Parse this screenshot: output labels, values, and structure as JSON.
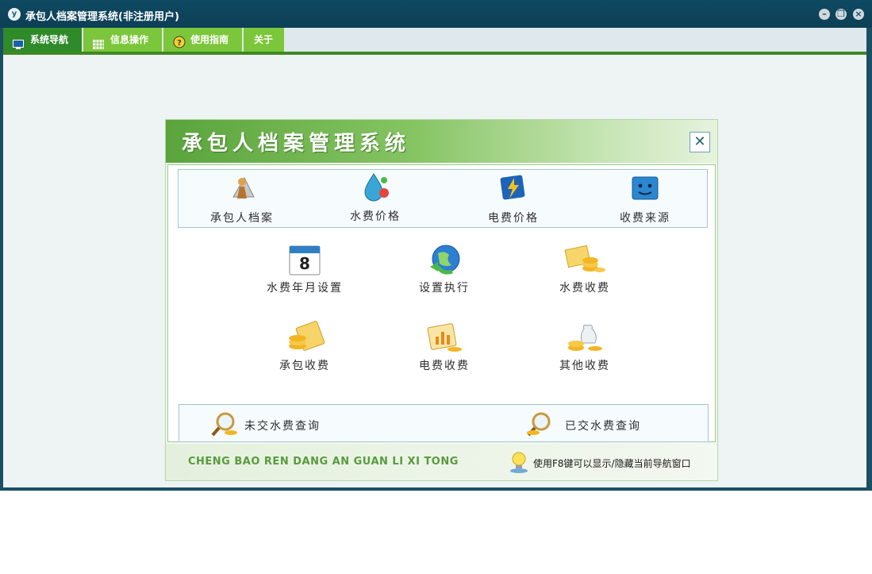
{
  "window": {
    "title": "承包人档案管理系统(非注册用户)",
    "app_icon_letter": "y",
    "controls": {
      "minimize": "–",
      "restore": "❐",
      "close": "×"
    }
  },
  "menu": {
    "items": [
      {
        "label": "系统导航",
        "icon": "monitor-icon",
        "active": true
      },
      {
        "label": "信息操作",
        "icon": "grid-icon",
        "active": false
      },
      {
        "label": "使用指南",
        "icon": "help-icon",
        "active": false
      },
      {
        "label": "关于",
        "icon": "",
        "active": false
      }
    ]
  },
  "nav": {
    "title": "承包人档案管理系统",
    "close": "✕",
    "top_row": [
      {
        "label": "承包人档案",
        "icon": "contractor-profile-icon"
      },
      {
        "label": "水费价格",
        "icon": "water-drop-icon"
      },
      {
        "label": "电费价格",
        "icon": "lightning-icon"
      },
      {
        "label": "收费来源",
        "icon": "finder-face-icon"
      }
    ],
    "grid": [
      {
        "label": "水费年月设置",
        "icon": "calendar-icon",
        "calendar_day": "8"
      },
      {
        "label": "设置执行",
        "icon": "globe-refresh-icon"
      },
      {
        "label": "水费收费",
        "icon": "coins-stack-icon"
      },
      {
        "label": "承包收费",
        "icon": "coins-card-icon"
      },
      {
        "label": "电费收费",
        "icon": "chart-coins-icon"
      },
      {
        "label": "其他收费",
        "icon": "money-bag-icon"
      }
    ],
    "bottom_row": [
      {
        "label": "未交水费查询",
        "icon": "magnifier-coins-icon"
      },
      {
        "label": "已交水费查询",
        "icon": "magnifier-coins-icon"
      }
    ],
    "footer_pinyin": "CHENG BAO REN DANG AN GUAN LI XI TONG",
    "footer_hint": "使用F8键可以显示/隐藏当前导航窗口"
  },
  "colors": {
    "titlebar": "#0f4a62",
    "menu_active": "#2f8a2a",
    "menu_normal": "#7bc63a",
    "dialog_green": "#5aa43c"
  }
}
